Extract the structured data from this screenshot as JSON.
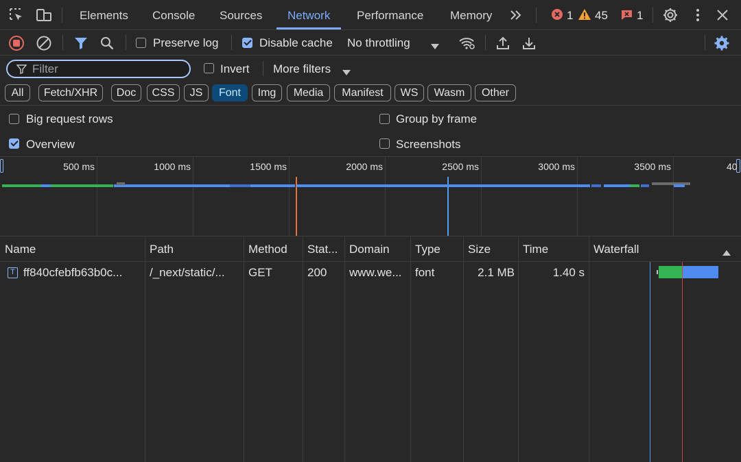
{
  "tabs": [
    {
      "label": "Elements",
      "active": false
    },
    {
      "label": "Console",
      "active": false
    },
    {
      "label": "Sources",
      "active": false
    },
    {
      "label": "Network",
      "active": true
    },
    {
      "label": "Performance",
      "active": false
    },
    {
      "label": "Memory",
      "active": false
    }
  ],
  "tab_overflow_icon": "chevron-double-right-icon",
  "status_badges": {
    "errors": "1",
    "warnings": "45",
    "issues": "1"
  },
  "toolbar": {
    "preserve_log_label": "Preserve log",
    "preserve_log_checked": false,
    "disable_cache_label": "Disable cache",
    "disable_cache_checked": true,
    "throttling_value": "No throttling"
  },
  "filter": {
    "placeholder": "Filter",
    "value": "",
    "invert_label": "Invert",
    "invert_checked": false,
    "more_filters_label": "More filters"
  },
  "type_chips": [
    {
      "label": "All",
      "selected": false
    },
    {
      "label": "Fetch/XHR",
      "selected": false
    },
    {
      "label": "Doc",
      "selected": false
    },
    {
      "label": "CSS",
      "selected": false
    },
    {
      "label": "JS",
      "selected": false
    },
    {
      "label": "Font",
      "selected": true
    },
    {
      "label": "Img",
      "selected": false
    },
    {
      "label": "Media",
      "selected": false
    },
    {
      "label": "Manifest",
      "selected": false
    },
    {
      "label": "WS",
      "selected": false
    },
    {
      "label": "Wasm",
      "selected": false
    },
    {
      "label": "Other",
      "selected": false
    }
  ],
  "settings": {
    "big_request_rows_label": "Big request rows",
    "big_request_rows_checked": false,
    "overview_label": "Overview",
    "overview_checked": true,
    "group_by_frame_label": "Group by frame",
    "group_by_frame_checked": false,
    "screenshots_label": "Screenshots",
    "screenshots_checked": false
  },
  "overview": {
    "tick_labels": [
      "500 ms",
      "1000 ms",
      "1500 ms",
      "2000 ms",
      "2500 ms",
      "3000 ms",
      "3500 ms",
      "40"
    ],
    "dom_content_loaded_ms": 1535,
    "load_ms": 2325,
    "colors": {
      "dom_content_loaded": "#e8703a",
      "load": "#4f9ef0",
      "waiting": "#34b352",
      "download": "#4e8cf2"
    }
  },
  "columns": [
    "Name",
    "Path",
    "Method",
    "Stat...",
    "Domain",
    "Type",
    "Size",
    "Time",
    "Waterfall"
  ],
  "sort_icon": "triangle-up-icon",
  "rows": [
    {
      "icon": "font-file-icon",
      "name": "ff840cfebfb63b0c...",
      "path": "/_next/static/...",
      "method": "GET",
      "status": "200",
      "domain": "www.we...",
      "type": "font",
      "size": "2.1 MB",
      "time": "1.40 s"
    }
  ]
}
